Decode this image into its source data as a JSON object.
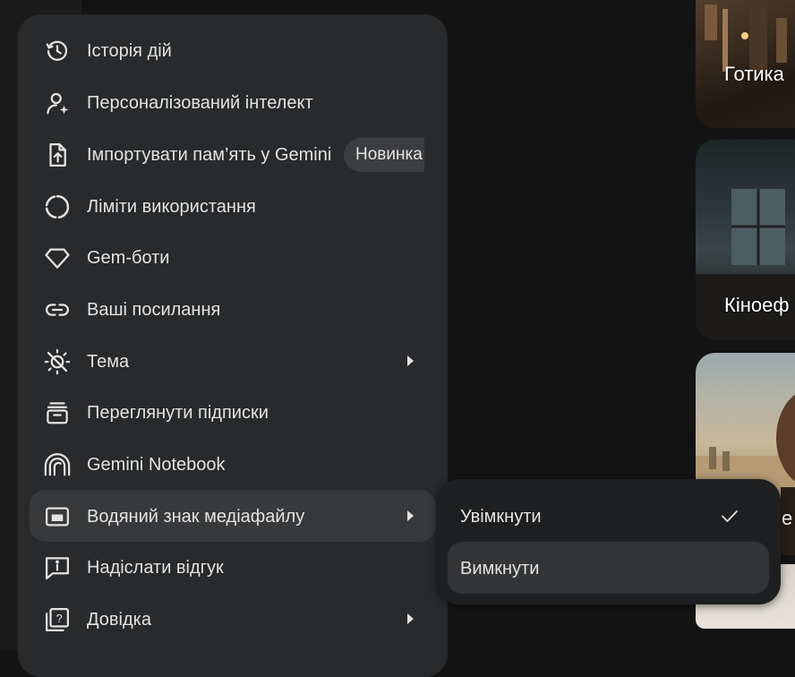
{
  "menu": {
    "items": [
      {
        "label": "Історія дій",
        "icon": "history-icon"
      },
      {
        "label": "Персоналізований інтелект",
        "icon": "person-sparkle-icon"
      },
      {
        "label": "Імпортувати пам’ять у Gemini",
        "icon": "file-upload-icon",
        "badge": "Новинка"
      },
      {
        "label": "Ліміти використання",
        "icon": "usage-ring-icon"
      },
      {
        "label": "Gem-боти",
        "icon": "gem-icon"
      },
      {
        "label": "Ваші посилання",
        "icon": "link-icon"
      },
      {
        "label": "Тема",
        "icon": "theme-sun-icon",
        "has_submenu": true
      },
      {
        "label": "Переглянути підписки",
        "icon": "subscriptions-icon"
      },
      {
        "label": "Gemini Notebook",
        "icon": "notebook-arcs-icon"
      },
      {
        "label": "Водяний знак медіафайлу",
        "icon": "watermark-icon",
        "has_submenu": true,
        "active": true
      },
      {
        "label": "Надіслати відгук",
        "icon": "feedback-icon"
      },
      {
        "label": "Довідка",
        "icon": "help-icon",
        "has_submenu": true
      }
    ]
  },
  "submenu": {
    "items": [
      {
        "label": "Увімкнути",
        "checked": true
      },
      {
        "label": "Вимкнути",
        "selected": true
      }
    ]
  },
  "background_cards": [
    {
      "label": "Готика"
    },
    {
      "label": "Кіноеф"
    },
    {
      "label": "е"
    }
  ],
  "colors": {
    "page_bg": "#131314",
    "menu_bg": "#282a2c",
    "active_item_bg": "#37393b",
    "submenu_bg": "#1e1f20",
    "text": "#e3e3e3"
  }
}
